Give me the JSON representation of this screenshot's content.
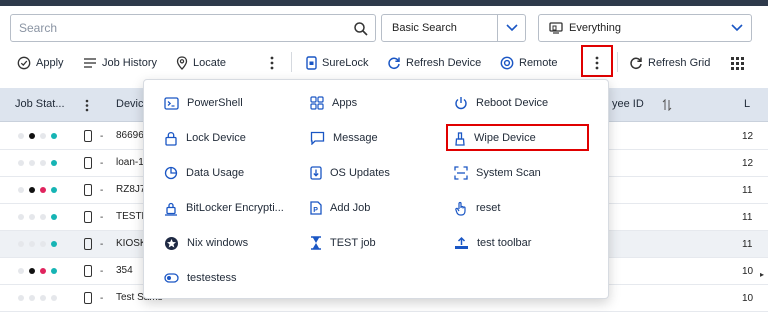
{
  "search": {
    "placeholder": "Search",
    "mode_label": "Basic Search",
    "scope_label": "Everything"
  },
  "toolbar": {
    "apply": "Apply",
    "job_history": "Job History",
    "locate": "Locate",
    "surelock": "SureLock",
    "refresh_device": "Refresh Device",
    "remote": "Remote",
    "refresh_grid": "Refresh Grid"
  },
  "grid": {
    "headers": {
      "job_status": "Job Stat...",
      "device": "Devic",
      "employee_id": "yee ID",
      "last": "L"
    },
    "rows": [
      {
        "name": "86696",
        "last": "12",
        "dots": [
          "#e5e7eb",
          "#111111",
          "#e5e7eb",
          "#16b4b4"
        ]
      },
      {
        "name": "loan-1",
        "last": "12",
        "dots": [
          "#e5e7eb",
          "#e5e7eb",
          "#e5e7eb",
          "#16b4b4"
        ]
      },
      {
        "name": "RZ8J7",
        "last": "11",
        "dots": [
          "#e5e7eb",
          "#111111",
          "#e0245e",
          "#16b4b4"
        ]
      },
      {
        "name": "TESTN",
        "last": "11",
        "dots": [
          "#e5e7eb",
          "#e5e7eb",
          "#e5e7eb",
          "#16b4b4"
        ]
      },
      {
        "name": "KIOSK",
        "last": "11",
        "dots": [
          "#e5e7eb",
          "#e5e7eb",
          "#e5e7eb",
          "#16b4b4"
        ]
      },
      {
        "name": "354",
        "last": "10",
        "dots": [
          "#e5e7eb",
          "#111111",
          "#e0245e",
          "#16b4b4"
        ]
      },
      {
        "name": "Test Sams",
        "last": "10",
        "dots": [
          "#e5e7eb",
          "#e5e7eb",
          "#e5e7eb",
          "#e5e7eb"
        ]
      }
    ]
  },
  "menu": {
    "col1": [
      "PowerShell",
      "Lock Device",
      "Data Usage",
      "BitLocker Encrypti...",
      "Nix windows",
      "testestess"
    ],
    "col2": [
      "Apps",
      "Message",
      "OS Updates",
      "Add Job",
      "TEST job"
    ],
    "col3": [
      "Reboot Device",
      "Wipe Device",
      "System Scan",
      "reset",
      "test toolbar"
    ]
  },
  "colors": {
    "accent": "#1a56c4",
    "highlight": "#e00000",
    "header_bg": "#dde4ee"
  }
}
